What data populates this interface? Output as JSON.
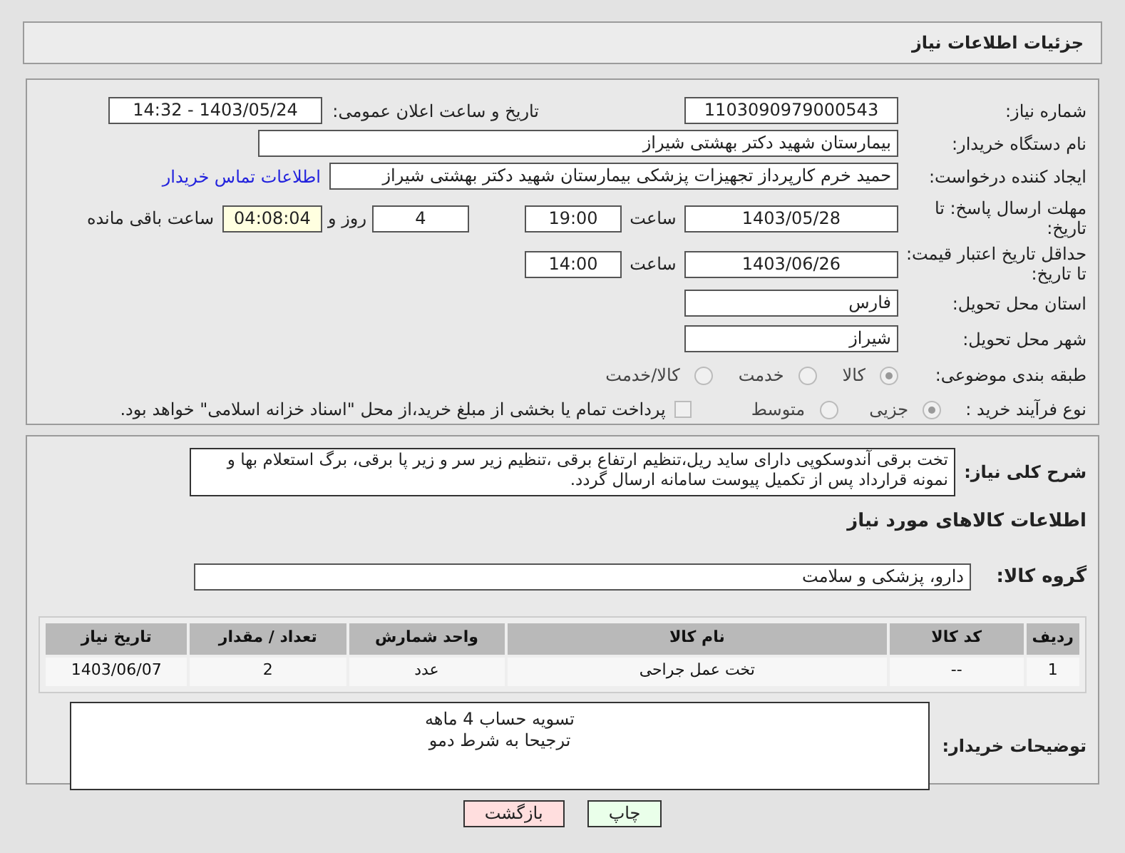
{
  "header": {
    "title": "جزئیات اطلاعات نیاز"
  },
  "need_number": {
    "label": "شماره نیاز:",
    "value": "1103090979000543"
  },
  "announce": {
    "label": "تاریخ و ساعت اعلان عمومی:",
    "value": "1403/05/24 - 14:32"
  },
  "buyer": {
    "label": "نام دستگاه خریدار:",
    "value": "بیمارستان شهید دکتر بهشتی شیراز"
  },
  "requester": {
    "label": "ایجاد کننده درخواست:",
    "value": "حمید خرم کارپرداز تجهیزات پزشکی بیمارستان شهید دکتر بهشتی شیراز",
    "link": "اطلاعات تماس خریدار"
  },
  "deadline": {
    "label": "مهلت ارسال پاسخ: تا تاریخ:",
    "date": "1403/05/28",
    "time_label": "ساعت",
    "time": "19:00",
    "days": "4",
    "days_label": "روز و",
    "remaining": "04:08:04",
    "remaining_label": "ساعت باقی مانده"
  },
  "validity": {
    "label": "حداقل تاریخ اعتبار قیمت: تا تاریخ:",
    "date": "1403/06/26",
    "time_label": "ساعت",
    "time": "14:00"
  },
  "province": {
    "label": "استان محل تحویل:",
    "value": "فارس"
  },
  "city": {
    "label": "شهر محل تحویل:",
    "value": "شیراز"
  },
  "category": {
    "label": "طبقه بندی موضوعی:",
    "options": [
      {
        "label": "کالا",
        "selected": true
      },
      {
        "label": "خدمت",
        "selected": false
      },
      {
        "label": "کالا/خدمت",
        "selected": false
      }
    ]
  },
  "process": {
    "label": "نوع فرآیند خرید :",
    "options": [
      {
        "label": "جزیی",
        "selected": true
      },
      {
        "label": "متوسط",
        "selected": false
      }
    ],
    "treasury": {
      "label": "پرداخت تمام یا بخشی از مبلغ خرید،از محل \"اسناد خزانه اسلامی\" خواهد بود.",
      "checked": false
    }
  },
  "description": {
    "label": "شرح کلی نیاز:",
    "value": "تخت برقی آندوسکوپی دارای ساید ریل،تنظیم ارتفاع برقی ،تنظیم زیر سر و زیر پا برقی، برگ استعلام بها و نمونه قرارداد پس از تکمیل پیوست سامانه ارسال گردد."
  },
  "goods_heading": "اطلاعات کالاهای مورد نیاز",
  "goods_group": {
    "label": "گروه کالا:",
    "value": "دارو، پزشکی و سلامت"
  },
  "table": {
    "columns": [
      "ردیف",
      "کد کالا",
      "نام کالا",
      "واحد شمارش",
      "تعداد / مقدار",
      "تاریخ نیاز"
    ],
    "rows": [
      [
        "1",
        "--",
        "تخت عمل جراحی",
        "عدد",
        "2",
        "1403/06/07"
      ]
    ]
  },
  "buyer_notes": {
    "label": "توضیحات خریدار:",
    "lines": [
      "تسویه حساب 4 ماهه",
      "ترجیحا به شرط دمو"
    ]
  },
  "buttons": [
    {
      "label": "چاپ",
      "kind": "print"
    },
    {
      "label": "بازگشت",
      "kind": "back"
    }
  ]
}
